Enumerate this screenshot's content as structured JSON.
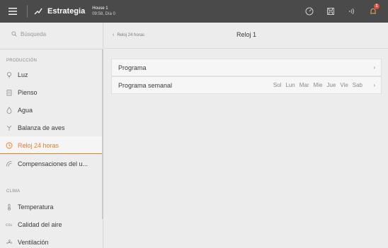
{
  "topbar": {
    "menu_icon": "hamburger-icon",
    "app_icon": "chart-line-icon",
    "app_title": "Estrategia",
    "house_name": "House 1",
    "house_status": "09:58, Día 0",
    "icons": [
      "gauge-icon",
      "save-icon",
      "signal-icon",
      "bell-icon"
    ],
    "notification_count": "1"
  },
  "sidebar": {
    "search_placeholder": "Búsqueda",
    "sections": [
      {
        "label": "PRODUCCIÓN",
        "items": [
          {
            "label": "Luz",
            "icon": "bulb-icon"
          },
          {
            "label": "Pienso",
            "icon": "feed-icon"
          },
          {
            "label": "Agua",
            "icon": "drop-icon"
          },
          {
            "label": "Balanza de aves",
            "icon": "scale-icon"
          },
          {
            "label": "Reloj 24 horas",
            "icon": "clock-icon",
            "active": true
          },
          {
            "label": "Compensaciones del u...",
            "icon": "compensation-icon"
          }
        ]
      },
      {
        "label": "CLIMA",
        "items": [
          {
            "label": "Temperatura",
            "icon": "thermometer-icon"
          },
          {
            "label": "Calidad del aire",
            "icon": "co2-icon"
          },
          {
            "label": "Ventilación",
            "icon": "fan-icon"
          }
        ]
      }
    ]
  },
  "main": {
    "back_label": "Reloj 24 horas",
    "title": "Reloj 1",
    "rows": [
      {
        "label": "Programa"
      },
      {
        "label": "Programa semanal",
        "days": [
          "Sol",
          "Lun",
          "Mar",
          "Mie",
          "Jue",
          "Vie",
          "Sab"
        ]
      }
    ]
  },
  "colors": {
    "accent": "#f07d2a",
    "topbar": "#4a4a4a",
    "background": "#ececec",
    "badge": "#e64a3b"
  }
}
